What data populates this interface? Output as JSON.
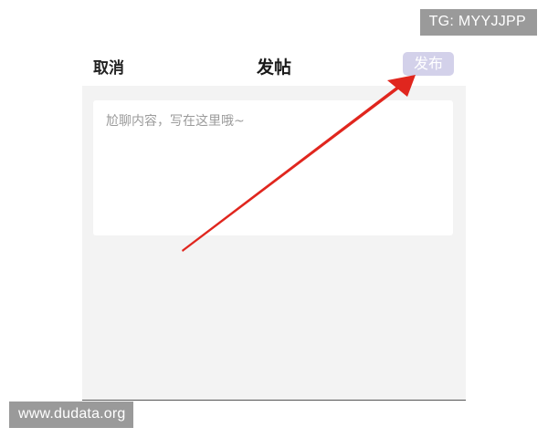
{
  "watermarks": {
    "top_right": "TG: MYYJJPP",
    "bottom_left": "www.dudata.org"
  },
  "header": {
    "cancel_label": "取消",
    "title": "发帖",
    "publish_label": "发布"
  },
  "editor": {
    "value": "",
    "placeholder": "尬聊内容，写在这里哦~"
  },
  "colors": {
    "publish_button": "#d3d1ea",
    "arrow": "#e0261e",
    "body_background": "#f3f3f3"
  }
}
